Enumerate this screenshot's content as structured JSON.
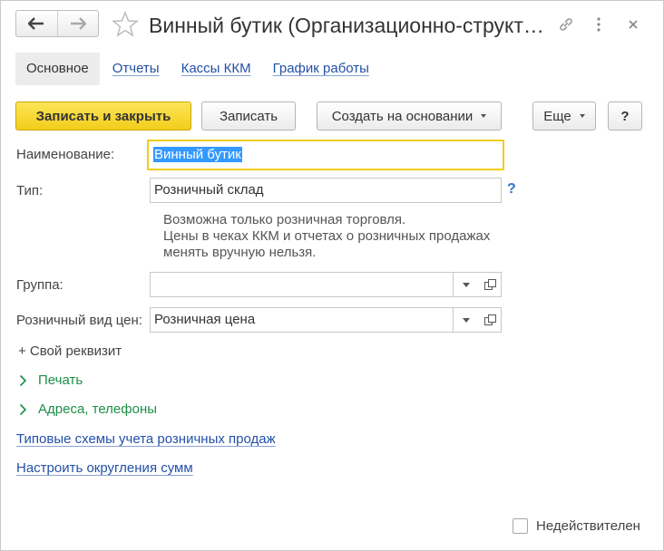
{
  "window": {
    "title": "Винный бутик (Организационно-структ…",
    "icons": {
      "back": "arrow-left-icon",
      "forward": "arrow-right-icon",
      "favorite": "star-icon",
      "link": "link-icon",
      "menu": "more-vertical-icon",
      "close": "close-icon"
    }
  },
  "tabs": [
    {
      "label": "Основное",
      "active": true
    },
    {
      "label": "Отчеты",
      "active": false
    },
    {
      "label": "Кассы ККМ",
      "active": false
    },
    {
      "label": "График работы",
      "active": false
    }
  ],
  "toolbar": {
    "save_close_label": "Записать и закрыть",
    "save_label": "Записать",
    "create_based_label": "Создать на основании",
    "more_label": "Еще",
    "help_label": "?"
  },
  "form": {
    "name": {
      "label": "Наименование:",
      "value": "Винный бутик"
    },
    "type": {
      "label": "Тип:",
      "value": "Розничный склад",
      "help": "?"
    },
    "hint_lines": [
      "Возможна только розничная торговля.",
      "Цены в чеках ККМ и отчетах о розничных продажах",
      "менять вручную нельзя."
    ],
    "group": {
      "label": "Группа:",
      "value": ""
    },
    "price_type": {
      "label": "Розничный вид цен:",
      "value": "Розничная цена"
    }
  },
  "add_requisite": "+ Свой реквизит",
  "collapsible_groups": [
    {
      "label": "Печать"
    },
    {
      "label": "Адреса, телефоны"
    }
  ],
  "links": [
    {
      "label": "Типовые схемы учета розничных продаж"
    },
    {
      "label": "Настроить округления сумм"
    }
  ],
  "inactive_checkbox": {
    "label": "Недействителен",
    "checked": false
  },
  "colors": {
    "accent_yellow": "#f2cd1a",
    "link_blue": "#2350a8",
    "group_green": "#1c8f48",
    "selection": "#3399ff"
  }
}
